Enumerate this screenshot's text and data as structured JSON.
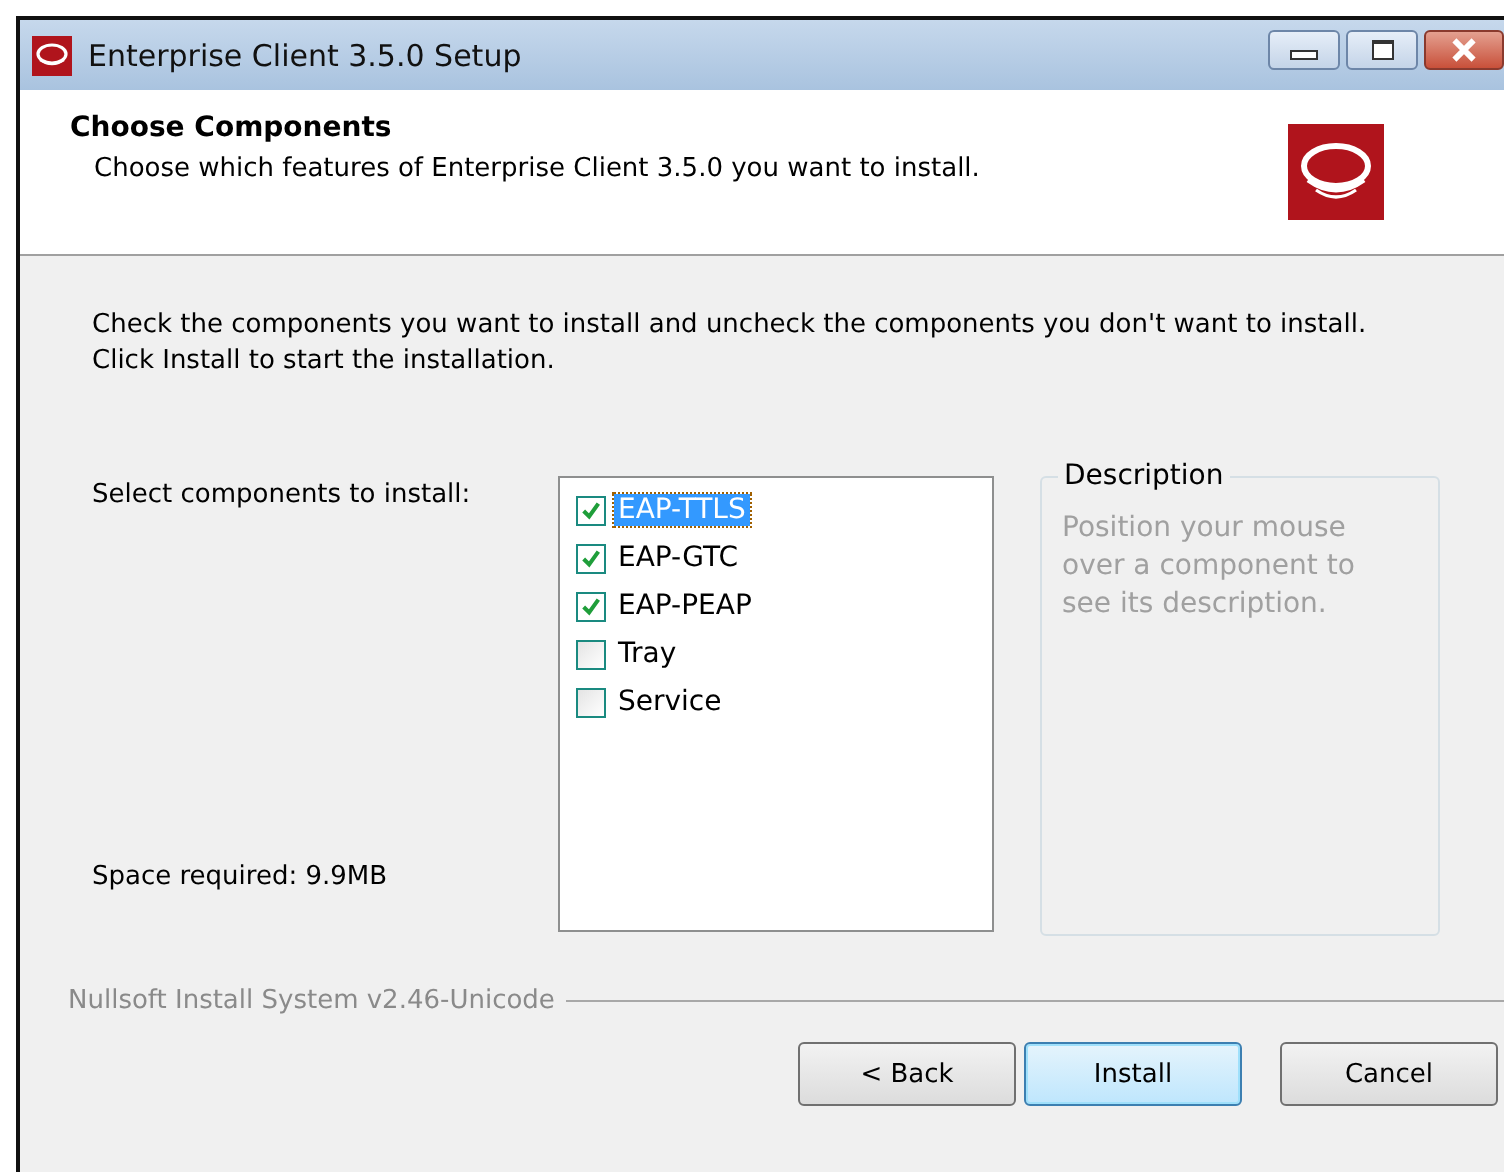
{
  "window": {
    "title": "Enterprise Client 3.5.0 Setup"
  },
  "header": {
    "title": "Choose Components",
    "subtitle": "Choose which features of Enterprise Client 3.5.0 you want to install."
  },
  "instructions": "Check the components you want to install and uncheck the components you don't want to install. Click Install to start the installation.",
  "select_label": "Select components to install:",
  "space_required": "Space required: 9.9MB",
  "components": [
    {
      "label": "EAP-TTLS",
      "checked": true,
      "selected": true
    },
    {
      "label": "EAP-GTC",
      "checked": true,
      "selected": false
    },
    {
      "label": "EAP-PEAP",
      "checked": true,
      "selected": false
    },
    {
      "label": "Tray",
      "checked": false,
      "selected": false
    },
    {
      "label": "Service",
      "checked": false,
      "selected": false
    }
  ],
  "description": {
    "title": "Description",
    "text": "Position your mouse over a component to see its description."
  },
  "branding": "Nullsoft Install System v2.46-Unicode",
  "buttons": [
    {
      "label": "< Back",
      "default": false
    },
    {
      "label": "Install",
      "default": true
    },
    {
      "label": "Cancel",
      "default": false
    }
  ]
}
